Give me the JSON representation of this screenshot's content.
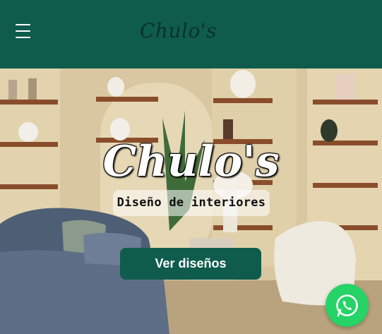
{
  "header": {
    "brand": "Chulo's"
  },
  "hero": {
    "title": "Chulo's",
    "subtitle": "Diseño de interiores",
    "cta_label": "Ver diseños"
  },
  "colors": {
    "brand_green": "#0f5c4d",
    "whatsapp_green": "#25d366"
  },
  "icons": {
    "menu": "hamburger-menu-icon",
    "whatsapp": "whatsapp-icon"
  }
}
